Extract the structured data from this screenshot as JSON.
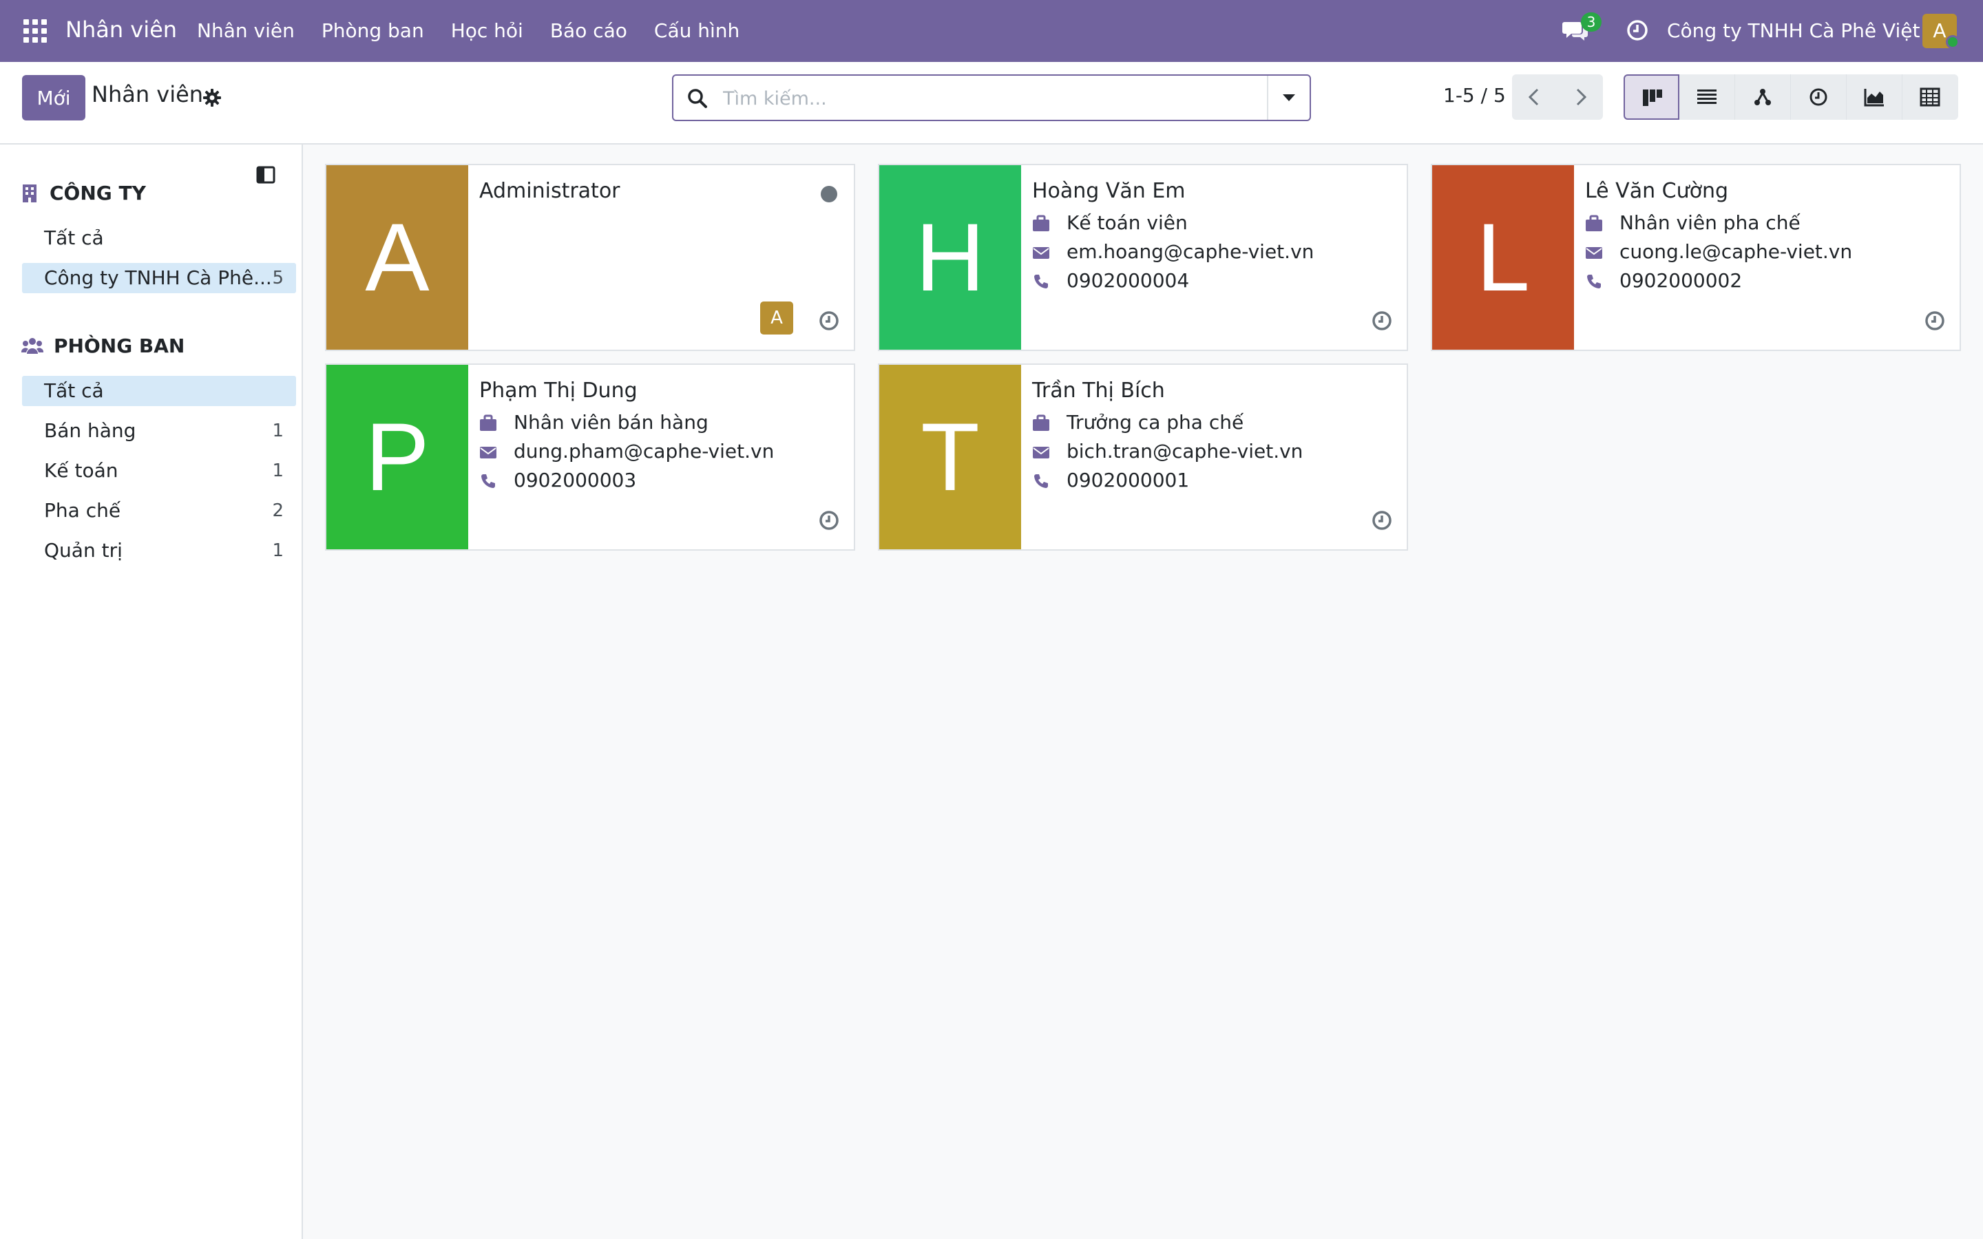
{
  "navbar": {
    "brand": "Nhân viên",
    "menu": [
      "Nhân viên",
      "Phòng ban",
      "Học hỏi",
      "Báo cáo",
      "Cấu hình"
    ],
    "chat_count": "3",
    "company": "Công ty TNHH Cà Phê Việt",
    "user_initial": "A"
  },
  "control_panel": {
    "new_label": "Mới",
    "title": "Nhân viên",
    "search_placeholder": "Tìm kiếm...",
    "pager": "1-5 / 5"
  },
  "sidebar": {
    "company_header": "CÔNG TY",
    "company_items": [
      {
        "label": "Tất cả",
        "count": ""
      },
      {
        "label": "Công ty TNHH Cà Phê...",
        "count": "5"
      }
    ],
    "department_header": "PHÒNG BAN",
    "department_items": [
      {
        "label": "Tất cả",
        "count": ""
      },
      {
        "label": "Bán hàng",
        "count": "1"
      },
      {
        "label": "Kế toán",
        "count": "1"
      },
      {
        "label": "Pha chế",
        "count": "2"
      },
      {
        "label": "Quản trị",
        "count": "1"
      }
    ]
  },
  "employees": [
    {
      "initial": "A",
      "name": "Administrator",
      "color": "#b58834",
      "job": "",
      "email": "",
      "phone": "",
      "user_badge": "A"
    },
    {
      "initial": "H",
      "name": "Hoàng Văn Em",
      "color": "#28bf62",
      "job": "Kế toán viên",
      "email": "em.hoang@caphe-viet.vn",
      "phone": "0902000004"
    },
    {
      "initial": "L",
      "name": "Lê Văn Cường",
      "color": "#c24e27",
      "job": "Nhân viên pha chế",
      "email": "cuong.le@caphe-viet.vn",
      "phone": "0902000002"
    },
    {
      "initial": "P",
      "name": "Phạm Thị Dung",
      "color": "#2dbb3a",
      "job": "Nhân viên bán hàng",
      "email": "dung.pham@caphe-viet.vn",
      "phone": "0902000003"
    },
    {
      "initial": "T",
      "name": "Trần Thị Bích",
      "color": "#bca12b",
      "job": "Trưởng ca pha chế",
      "email": "bich.tran@caphe-viet.vn",
      "phone": "0902000001"
    }
  ],
  "colors": {
    "primary": "#71639e",
    "active_filter": "#d6e9f8"
  }
}
